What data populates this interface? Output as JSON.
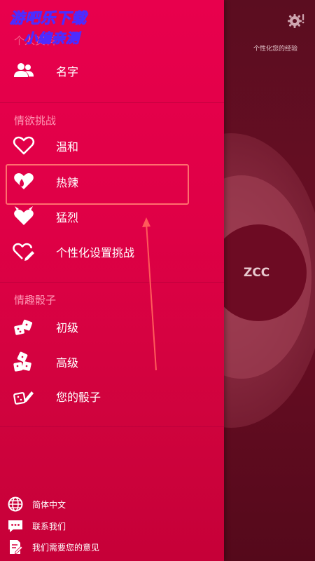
{
  "watermark": {
    "line1": "游吧乐下载",
    "line2": "小编亲测"
  },
  "background": {
    "circle_label": "ZCC",
    "personalize_text": "个性化您的经验"
  },
  "sections": {
    "top_partial": "个人资料",
    "passion": "情欲挑战",
    "dice": "情趣骰子"
  },
  "menu": {
    "name": "名字",
    "mild": "温和",
    "hot": "热辣",
    "fierce": "猛烈",
    "custom_challenge": "个性化设置挑战",
    "beginner": "初级",
    "advanced": "高级",
    "your_dice": "您的骰子"
  },
  "footer": {
    "language": "简体中文",
    "contact": "联系我们",
    "feedback": "我们需要您的意见"
  },
  "colors": {
    "drawer_top": "#e8004d",
    "drawer_bottom": "#c60038",
    "section_text": "#ff97b4",
    "highlight": "#ff6e6e",
    "bg_panel": "#5b0d20"
  }
}
